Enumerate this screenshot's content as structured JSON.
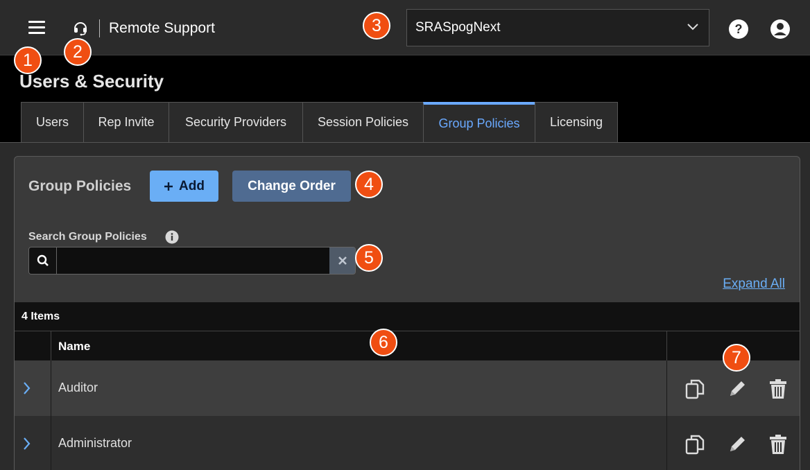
{
  "header": {
    "brand": "Remote Support",
    "site_selector": "SRASpogNext"
  },
  "callouts": [
    "1",
    "2",
    "3",
    "4",
    "5",
    "6",
    "7"
  ],
  "page": {
    "title": "Users & Security"
  },
  "tabs": [
    {
      "label": "Users",
      "active": false
    },
    {
      "label": "Rep Invite",
      "active": false
    },
    {
      "label": "Security Providers",
      "active": false
    },
    {
      "label": "Session Policies",
      "active": false
    },
    {
      "label": "Group Policies",
      "active": true
    },
    {
      "label": "Licensing",
      "active": false
    }
  ],
  "panel": {
    "title": "Group Policies",
    "add_label": "Add",
    "change_order_label": "Change Order",
    "search_label": "Search Group Policies",
    "search_value": "",
    "expand_all": "Expand All",
    "count": "4 Items",
    "column_name": "Name",
    "rows": [
      {
        "name": "Auditor"
      },
      {
        "name": "Administrator"
      }
    ]
  },
  "icons": [
    "hamburger-icon",
    "headset-icon",
    "chevron-down-icon",
    "help-icon",
    "user-icon",
    "plus-icon",
    "info-icon",
    "search-icon",
    "close-icon",
    "chevron-right-icon",
    "copy-icon",
    "edit-icon",
    "trash-icon"
  ],
  "colors": {
    "accent": "#6aaef5",
    "callout": "#f04e12",
    "secondary_button": "#4f6b91"
  }
}
